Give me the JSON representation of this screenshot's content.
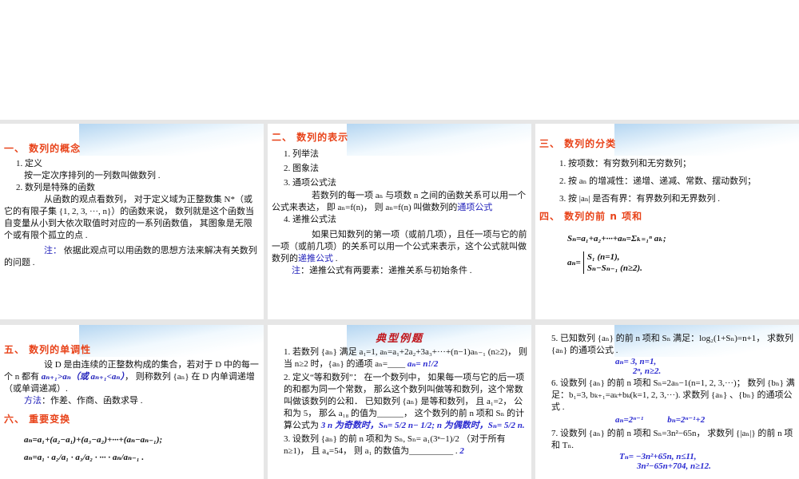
{
  "s1": {
    "title": "一、 数列的概念",
    "l1": "1. 定义",
    "l2": "按一定次序排列的一列数叫做数列 .",
    "l3": "2. 数列是特殊的函数",
    "l4": "从函数的观点看数列， 对于定义域为正整数集 N*（或它的有限子集 {1, 2, 3, ···, n}）的函数来说， 数列就是这个函数当自变量从小到大依次取值时对应的一系列函数值， 其图象是无限个或有限个孤立的点 .",
    "note_label": "注：",
    "note": " 依据此观点可以用函数的思想方法来解决有关数列的问题 ."
  },
  "s2": {
    "title": "二、 数列的表示",
    "l1": "1. 列举法",
    "l2": "2. 图象法",
    "l3": "3. 通项公式法",
    "l4": "若数列的每一项 aₙ 与项数 n 之间的函数关系可以用一个公式来表达， 即 aₙ=f(n)， 则 aₙ=f(n) 叫做数列的",
    "l4_link": "通项公式",
    "l5": "4. 递推公式法",
    "l6": "如果已知数列的第一项（或前几项），且任一项与它的前一项（或前几项）的关系可以用一个公式来表示，这个公式就叫做数列的",
    "l6_link": "递推公式",
    "l6_end": " .",
    "note_label": "注",
    "note": "：递推公式有两要素：递推关系与初始条件 ."
  },
  "s3": {
    "title": "三、 数列的分类",
    "l1": "1. 按项数：有穷数列和无穷数列；",
    "l2": "2. 按 aₙ 的增减性：递增、递减、常数、摆动数列；",
    "l3": "3. 按 |aₙ| 是否有界：有界数列和无界数列 .",
    "title2": "四、 数列的前  n  项和",
    "f1": "Sₙ=a₁+a₂+···+aₙ=Σₖ₌₁ⁿ aₖ;",
    "f2a": "S₁        (n=1),",
    "f2b": "Sₙ−Sₙ₋₁ (n≥2).",
    "f2_lhs": "aₙ="
  },
  "s4": {
    "title": "五、 数列的单调性",
    "l1": "设 D 是由连续的正整数构成的集合，若对于 D 中的每一个 n 都有 ",
    "cond": "aₙ₊₁>aₙ（或 aₙ₊₁<aₙ）",
    "l1b": "， 则称数列 {aₙ} 在 D 内单调递增（或单调递减）.",
    "method_label": "方法",
    "method": "：作差、作商、函数求导 .",
    "title2": "六、 重要变换",
    "f1": "aₙ=a₁+(a₂−a₁)+(a₃−a₂)+···+(aₙ−aₙ₋₁);",
    "f2": "aₙ=a₁ · a₂/a₁ · a₃/a₂ · ··· · aₙ/aₙ₋₁ ."
  },
  "s5": {
    "title": "典型例题",
    "q1": "1. 若数列 {aₙ} 满足 a₁=1, aₙ=a₁+2a₂+3a₃+···+(n−1)aₙ₋₁ (n≥2)， 则当  n≥2 时，{aₙ} 的通项  aₙ=____",
    "a1": "aₙ= n!/2",
    "q2": "2. 定义“等和数列”： 在一个数列中， 如果每一项与它的后一项的和都为同一个常数， 那么这个数列叫做等和数列，这个常数叫做该数列的公和． 已知数列 {aₙ} 是等和数列， 且 a₁=2， 公和为 5， 那么 a₁₈ 的值为______， 这个数列的前 n 项和 Sₙ 的计算公式为",
    "a2a": "3",
    "a2b": "n 为奇数时，Sₙ= 5/2 n− 1/2; n 为偶数时，Sₙ= 5/2 n.",
    "q3": "3. 设数列 {aₙ} 的前 n 项和为 Sₙ, Sₙ= a₁(3ⁿ−1)/2 （对于所有 n≥1)， 且 a₄=54， 则 a₁ 的数值为__________ .",
    "a3": "2"
  },
  "s6": {
    "q5": "5. 已知数列 {aₙ} 的前 n 项和 Sₙ 满足：log₂(1+Sₙ)=n+1， 求数列 {aₙ} 的通项公式 .",
    "a5a": "aₙ= 3, n=1,",
    "a5b": "2ⁿ, n≥2.",
    "q6": "6. 设数列 {aₙ} 的前 n 项和 Sₙ=2aₙ−1(n=1, 2, 3,···)； 数列 {bₙ} 满足：b₁=3, bₖ₊₁=aₖ+bₖ(k=1, 2, 3,···). 求数列 {aₙ} 、{bₙ} 的通项公式 .",
    "a6a": "aₙ=2ⁿ⁻¹",
    "a6b": "bₙ=2ⁿ⁻¹+2",
    "q7": "7. 设数列 {aₙ} 的前 n 项和 Sₙ=3n²−65n， 求数列 {|aₙ|} 的前 n 项和 Tₙ.",
    "a7a": "Tₙ= −3n²+65n, n≤11,",
    "a7b": "3n²−65n+704, n≥12."
  },
  "colors": {
    "heading": "#e8431a",
    "answer": "#2a2ad0",
    "note": "#2222bb"
  }
}
